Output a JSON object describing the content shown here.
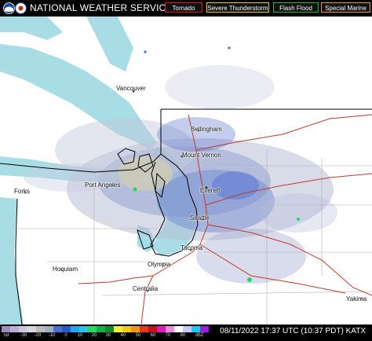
{
  "header": {
    "title": "NATIONAL WEATHER SERVICE",
    "warnings": [
      {
        "label": "Tornado",
        "color": "#ee1111"
      },
      {
        "label": "Severe Thunderstorm",
        "color": "#f1d200"
      },
      {
        "label": "Flash Flood",
        "color": "#1ebd3a"
      },
      {
        "label": "Special Marine",
        "color": "#ff9a00"
      }
    ]
  },
  "map": {
    "water_color": "#a8dde6",
    "land_color": "#ffffff",
    "road_color": "#c0392b",
    "cities": {
      "vancouver": "Vancouver",
      "bellingham": "Bellingham",
      "mount_vernon": "Mount Vernon",
      "everett": "Everett",
      "port_angeles": "Port Angeles",
      "forks": "Forks",
      "seattle": "Seattle",
      "tacoma": "Tacoma",
      "olympia": "Olympia",
      "hoquiam": "Hoquiam",
      "centralia": "Centralia",
      "yakima": "Yakima"
    }
  },
  "legend": {
    "unit": "dBZ",
    "nd": "nd",
    "ticks": [
      "-30",
      "-20",
      "-10",
      "0",
      "10",
      "20",
      "30",
      "40",
      "50",
      "60",
      "70",
      "80"
    ],
    "colors": [
      "#9c8ebd",
      "#b9afd2",
      "#cfc7e0",
      "#d7d7d7",
      "#bcbcbc",
      "#9bb0c8",
      "#4d6fd6",
      "#3057c8",
      "#22a6f0",
      "#28c4e8",
      "#26d860",
      "#14b040",
      "#0a8c2a",
      "#f6f12a",
      "#f5c91d",
      "#f0941c",
      "#e8341c",
      "#c8101c",
      "#e01cb8",
      "#f08adc",
      "#ffffff",
      "#c8c8ff",
      "#1ec8f0",
      "#a01cdc"
    ],
    "timestamp": "08/11/2022 17:37 UTC (10:37 PDT)",
    "station": "KATX"
  }
}
